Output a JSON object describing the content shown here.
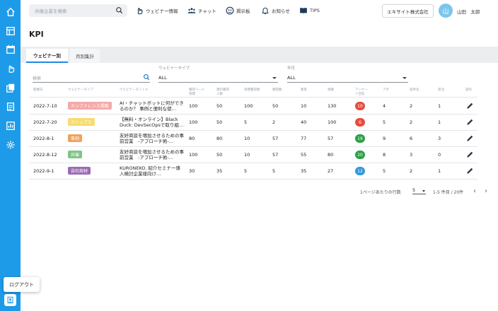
{
  "header": {
    "search_placeholder": "共催企業を検索",
    "nav": [
      {
        "label": "ウェビナー情報",
        "icon": "hand-pointer-icon"
      },
      {
        "label": "チャット",
        "icon": "group-icon"
      },
      {
        "label": "掲示板",
        "icon": "board-icon"
      },
      {
        "label": "お知らせ",
        "icon": "bell-icon"
      },
      {
        "label": "TIPS",
        "icon": "book-icon"
      }
    ],
    "company": "エキサイト株式会社",
    "avatar_initial": "山",
    "user_name": "山田　太郎"
  },
  "sidebar": {
    "items": [
      "home-icon",
      "dashboard-icon",
      "calendar-icon",
      "hand-pointer-icon",
      "copy-icon",
      "document-icon",
      "chart-icon",
      "settings-icon"
    ],
    "logout_label": "ログアウト"
  },
  "page": {
    "title": "KPI",
    "tabs": [
      {
        "label": "ウェビナー別",
        "active": true
      },
      {
        "label": "月別集計",
        "active": false
      }
    ]
  },
  "filters": {
    "search_placeholder": "検索",
    "type_label": "ウェビナータイプ",
    "type_value": "ALL",
    "year_label": "年月",
    "year_value": "ALL"
  },
  "table": {
    "columns": [
      "開催日",
      "ウェビナータイプ",
      "ウェビナータイトル",
      "獲得リード目標",
      "資料獲得人数",
      "目標獲得数",
      "獲得数",
      "集客",
      "視聴",
      "アンケート回答",
      "アポ",
      "案件化",
      "受注",
      "操作"
    ],
    "rows": [
      {
        "date": "2022-7-10",
        "type": "カンファレンス掲載",
        "type_color": "#f4a9a8",
        "title": "AI・チャットボットに何ができるのか？ 事例と便利な使…",
        "c1": "100",
        "c2": "50",
        "c3": "100",
        "c4": "50",
        "c5": "10",
        "c6": "130",
        "survey": "10",
        "survey_color": "#e74c3c",
        "c7": "4",
        "c8": "2",
        "c9": "1"
      },
      {
        "date": "2022-7-20",
        "type": "ティップス",
        "type_color": "#f7dc6f",
        "title": "【無料・オンライン】Black Duck: DevSecOpsで取り組…",
        "c1": "100",
        "c2": "50",
        "c3": "5",
        "c4": "2",
        "c5": "40",
        "c6": "100",
        "survey": "6",
        "survey_color": "#e74c3c",
        "c7": "5",
        "c8": "2",
        "c9": "1"
      },
      {
        "date": "2022-8-1",
        "type": "事例",
        "type_color": "#f0a25a",
        "title": "友好商談を増加させるための事前営業　-アプローチ術-…",
        "c1": "80",
        "c2": "80",
        "c3": "10",
        "c4": "57",
        "c5": "77",
        "c6": "57",
        "survey": "19",
        "survey_color": "#2e9e45",
        "c7": "9",
        "c8": "6",
        "c9": "3"
      },
      {
        "date": "2022-8-12",
        "type": "共催",
        "type_color": "#7ec488",
        "title": "友好商談を増加させるための事前営業　-アプローチ術-…",
        "c1": "100",
        "c2": "50",
        "c3": "10",
        "c4": "57",
        "c5": "55",
        "c6": "80",
        "survey": "20",
        "survey_color": "#2e9e45",
        "c7": "8",
        "c8": "3",
        "c9": "0"
      },
      {
        "date": "2022-9-1",
        "type": "自社商材",
        "type_color": "#9b6bb5",
        "title": "KURONEKO. 紹介セミナー導入検討企業様向け…",
        "c1": "30",
        "c2": "35",
        "c3": "5",
        "c4": "5",
        "c5": "35",
        "c6": "27",
        "survey": "12",
        "survey_color": "#3498db",
        "c7": "5",
        "c8": "2",
        "c9": "1"
      }
    ]
  },
  "pagination": {
    "rows_label": "1ページあたりの行数",
    "rows_value": "5",
    "range": "1-5 件目 / 20件"
  }
}
